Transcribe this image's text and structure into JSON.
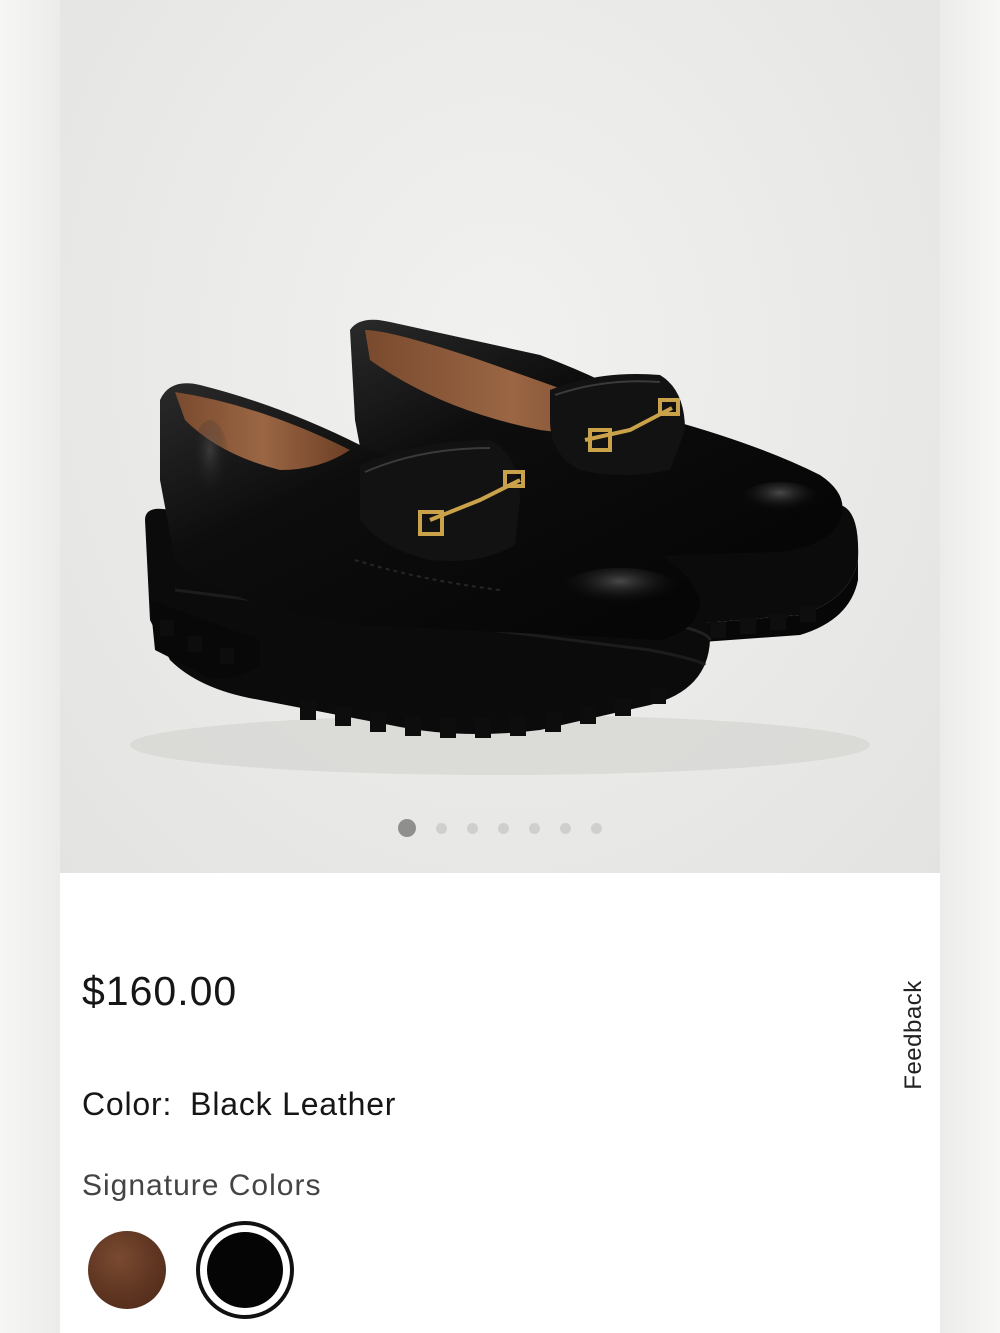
{
  "product": {
    "price": "$160.00",
    "color_label": "Color:",
    "color_value": "Black Leather",
    "signature_label": "Signature Colors",
    "swatches": [
      {
        "name": "brown",
        "color": "#5e3521",
        "selected": false
      },
      {
        "name": "black",
        "color": "#050505",
        "selected": true
      }
    ]
  },
  "carousel": {
    "count": 7,
    "active_index": 0
  },
  "feedback": {
    "label": "Feedback"
  },
  "colors": {
    "accent_gold": "#c9a24a",
    "leather_black": "#0d0d0d",
    "lining_brown": "#8a5a3c"
  }
}
